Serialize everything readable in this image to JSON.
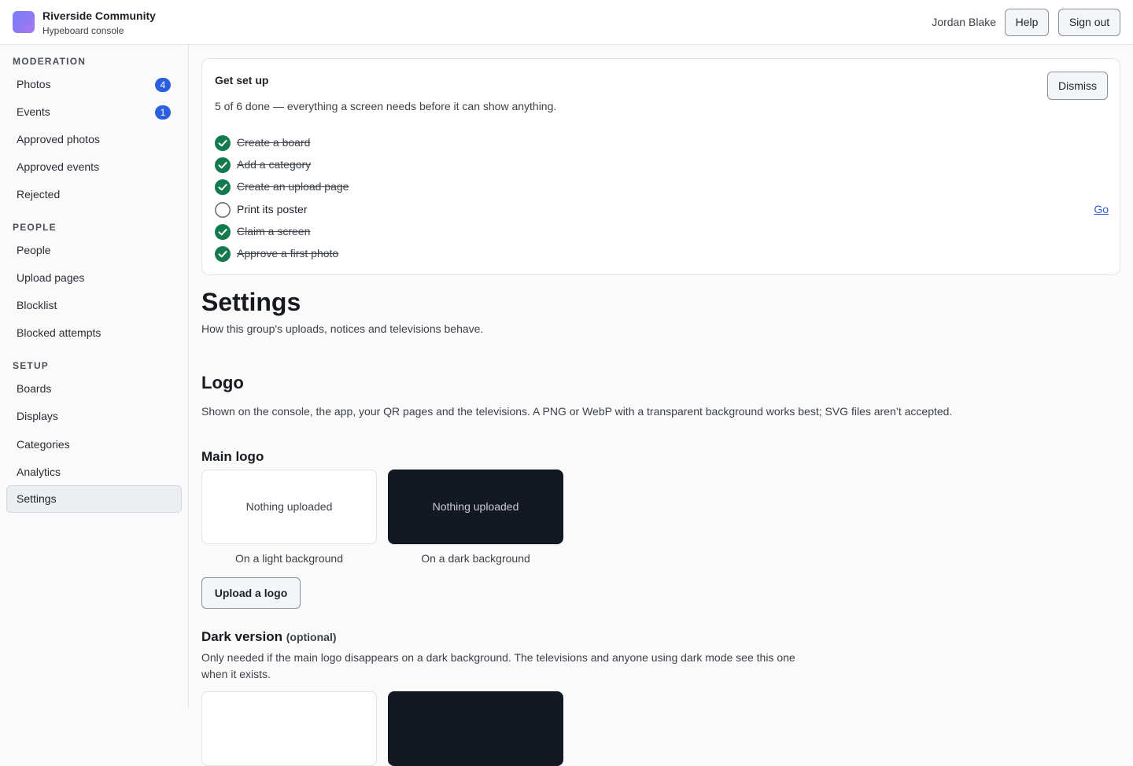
{
  "header": {
    "org_name": "Riverside Community",
    "subtitle": "Hypeboard console",
    "user_name": "Jordan Blake",
    "help_label": "Help",
    "sign_out_label": "Sign out",
    "brand_color": "#8d79f5"
  },
  "sidebar": {
    "sections": [
      {
        "heading": "MODERATION",
        "items": [
          {
            "label": "Photos",
            "badge": "4"
          },
          {
            "label": "Events",
            "badge": "1"
          },
          {
            "label": "Approved photos"
          },
          {
            "label": "Approved events"
          },
          {
            "label": "Rejected"
          }
        ]
      },
      {
        "heading": "PEOPLE",
        "items": [
          {
            "label": "People"
          },
          {
            "label": "Upload pages"
          },
          {
            "label": "Blocklist"
          },
          {
            "label": "Blocked attempts"
          }
        ]
      },
      {
        "heading": "SETUP",
        "items": [
          {
            "label": "Boards"
          },
          {
            "label": "Displays"
          },
          {
            "label": "Categories"
          },
          {
            "label": "Analytics"
          },
          {
            "label": "Settings",
            "active": true
          }
        ]
      }
    ],
    "badge_color": "#2c5fe0"
  },
  "setup_card": {
    "title": "Get set up",
    "progress_text": "5 of 6 done — everything a screen needs before it can show anything.",
    "dismiss_label": "Dismiss",
    "tasks": [
      {
        "label": "Create a board",
        "done": true
      },
      {
        "label": "Add a category",
        "done": true
      },
      {
        "label": "Create an upload page",
        "done": true
      },
      {
        "label": "Print its poster",
        "done": false,
        "action": "Go"
      },
      {
        "label": "Claim a screen",
        "done": true
      },
      {
        "label": "Approve a first photo",
        "done": true
      }
    ],
    "check_color": "#137a4f"
  },
  "main": {
    "title": "Settings",
    "description": "How this group's uploads, notices and televisions behave.",
    "logo_section": {
      "heading": "Logo",
      "description": "Shown on the console, the app, your QR pages and the televisions. A PNG or WebP with a transparent background works best; SVG files aren’t accepted.",
      "main_logo": {
        "heading": "Main logo",
        "light_tile_text": "Nothing uploaded",
        "dark_tile_text": "Nothing uploaded",
        "light_caption": "On a light background",
        "dark_caption": "On a dark background",
        "upload_label": "Upload a logo"
      },
      "dark_version": {
        "heading": "Dark version",
        "optional_tag": "(optional)",
        "description": "Only needed if the main logo disappears on a dark background. The televisions and anyone using dark mode see this one when it exists."
      }
    }
  }
}
